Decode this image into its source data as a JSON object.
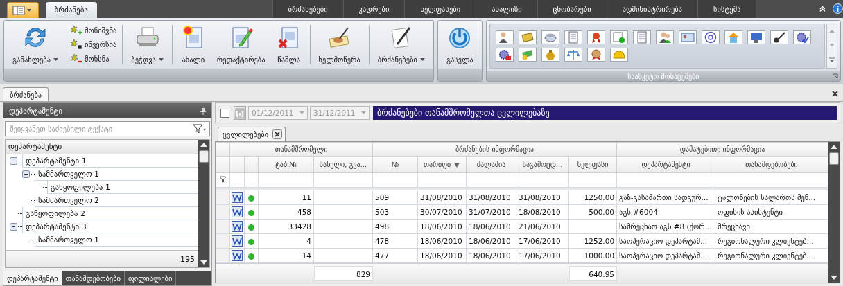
{
  "ribbon_tabs": [
    {
      "label": "ბრძანება",
      "selected": true
    },
    {
      "label": "ბრძანებები",
      "selected": false
    },
    {
      "label": "კადრები",
      "selected": false
    },
    {
      "label": "ხელფასები",
      "selected": false
    },
    {
      "label": "ანალიზი",
      "selected": false
    },
    {
      "label": "ცნობარები",
      "selected": false
    },
    {
      "label": "ადმინისტრირება",
      "selected": false
    },
    {
      "label": "სისტემა",
      "selected": false
    }
  ],
  "ribbon": {
    "groups": [
      {
        "sections": [
          [
            {
              "kind": "large",
              "label": "განახლება",
              "dropdown": true
            }
          ],
          [
            {
              "kind": "small",
              "label": "მონიშვნა"
            },
            {
              "kind": "small",
              "label": "ინვერსია"
            },
            {
              "kind": "small",
              "label": "მოხსნა"
            }
          ],
          [
            {
              "kind": "large",
              "label": "ბეჭდვა",
              "dropdown": true
            }
          ],
          [
            {
              "kind": "large",
              "label": "ახალი"
            },
            {
              "kind": "large",
              "label": "რედაქტირება"
            },
            {
              "kind": "large",
              "label": "წაშლა"
            }
          ],
          [
            {
              "kind": "large",
              "label": "ხელმოწერა"
            }
          ],
          [
            {
              "kind": "large",
              "label": "ბრძანებები",
              "dropdown": true
            }
          ]
        ]
      },
      {
        "sections": [
          [
            {
              "kind": "large",
              "label": "გასვლა"
            }
          ]
        ]
      }
    ],
    "gallery": {
      "caption": "საანკეტო მონაცემები"
    }
  },
  "document_tab": {
    "label": "ბრძანება"
  },
  "left_panel": {
    "title": "დეპარტამენტი",
    "search": {
      "placeholder": "შეიყვანეთ საძიებელი ტექსტი"
    },
    "tree_header": "დეპარტამენტი",
    "tree": [
      {
        "label": "დეპარტამენტი 1",
        "expanded": true,
        "children": [
          {
            "label": "სამმართველო 1",
            "expanded": true,
            "children": [
              {
                "label": "განყოფილება 1"
              }
            ]
          },
          {
            "label": "სამმართველო 2"
          }
        ]
      },
      {
        "label": "განყოფილება 2"
      },
      {
        "label": "დეპარტამენტი 3",
        "expanded": true,
        "children": [
          {
            "label": "სამმართველო 1"
          }
        ]
      }
    ],
    "footer_count": "195",
    "tabs": [
      {
        "label": "დეპარტამენტი",
        "selected": true
      },
      {
        "label": "თანამდებობები",
        "selected": false
      },
      {
        "label": "ფილიალები",
        "selected": false
      }
    ]
  },
  "filter_bar": {
    "checked": false,
    "date_from": {
      "value": "01/12/2011",
      "disabled": true
    },
    "date_to": {
      "value": "31/12/2011",
      "disabled": true
    },
    "title": "ბრძანებები თანამშრომელთა ცვლილებაზე"
  },
  "grid_tab": {
    "label": "ცვლილებები"
  },
  "grid": {
    "groups": [
      {
        "label": "თანამშრომელი"
      },
      {
        "label": "ბრძანების ინფორმაცია"
      },
      {
        "label": "დამატებითი ინფორმაცია"
      }
    ],
    "columns": [
      {
        "label": "ტაბ.№",
        "sorted": false
      },
      {
        "label": "სახელი, გვა...",
        "sorted": false
      },
      {
        "label": "№",
        "sorted": false
      },
      {
        "label": "თარიღი",
        "sorted": true
      },
      {
        "label": "ძალაშია",
        "sorted": false
      },
      {
        "label": "საგამოცდ...",
        "sorted": false
      },
      {
        "label": "ხელფასი",
        "sorted": false
      },
      {
        "label": "დეპარტამენტი",
        "sorted": false
      },
      {
        "label": "თანამდებობები",
        "sorted": false
      }
    ],
    "rows": [
      {
        "color": "#2fb52f",
        "tab_no": "11",
        "order_no": "509",
        "date": "31/08/2010",
        "effective": "31/08/2010",
        "probation": "31/08/2010",
        "salary": "1250.00",
        "department": "გაზ-გასამართი სადგურ...",
        "position": "ტალონების სალაროს მენ..."
      },
      {
        "color": "#2fb52f",
        "tab_no": "458",
        "order_no": "503",
        "date": "30/07/2010",
        "effective": "31/07/2010",
        "probation": "18/08/2010",
        "salary": "500.00",
        "department": "აგს #6004",
        "position": "ოფისის ასისტენტი"
      },
      {
        "color": "#2fb52f",
        "tab_no": "33428",
        "order_no": "498",
        "date": "18/06/2010",
        "effective": "18/06/2010",
        "probation": "21/06/2010",
        "department": "სამრეცხაო აგს #8 (ქორ...",
        "position": "მრეცხავი"
      },
      {
        "color": "#2fb52f",
        "tab_no": "4",
        "order_no": "478",
        "date": "18/06/2010",
        "effective": "18/06/2010",
        "probation": "17/06/2010",
        "salary": "1252.00",
        "department": "საოპერაციო დეპარტამ...",
        "position": "რეგიონალური კლიენტებ..."
      },
      {
        "color": "#2fb52f",
        "tab_no": "14",
        "order_no": "477",
        "date": "18/06/2010",
        "effective": "18/06/2010",
        "probation": "17/06/2010",
        "salary": "1000.00",
        "department": "საოპერაციო დეპარტამ...",
        "position": "რეგიონალური კლიენტებ..."
      }
    ],
    "footer": {
      "name_total": "829",
      "salary_total": "640.95"
    }
  }
}
